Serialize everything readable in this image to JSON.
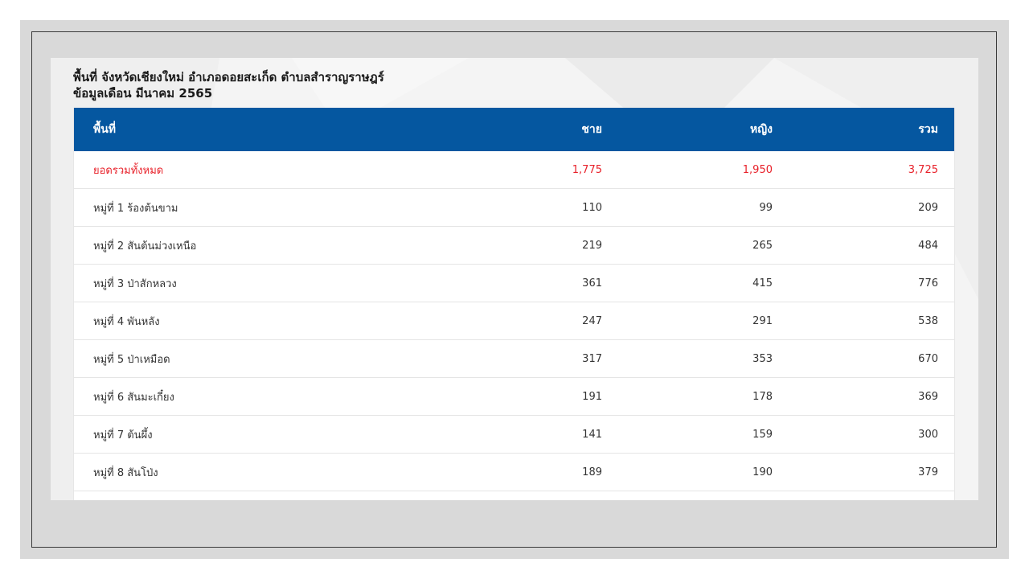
{
  "heading": {
    "line1": "พื้นที่ จังหวัดเชียงใหม่ อำเภอดอยสะเก็ด ตำบลสำราญราษฎร์",
    "line2": "ข้อมูลเดือน มีนาคม 2565"
  },
  "table": {
    "columns": [
      "พื้นที่",
      "ชาย",
      "หญิง",
      "รวม"
    ],
    "total": {
      "area": "ยอดรวมทั้งหมด",
      "male": "1,775",
      "female": "1,950",
      "sum": "3,725"
    },
    "rows": [
      {
        "area": "หมู่ที่ 1 ร้องต้นขาม",
        "male": "110",
        "female": "99",
        "sum": "209"
      },
      {
        "area": "หมู่ที่ 2 สันต้นม่วงเหนือ",
        "male": "219",
        "female": "265",
        "sum": "484"
      },
      {
        "area": "หมู่ที่ 3 ป่าสักหลวง",
        "male": "361",
        "female": "415",
        "sum": "776"
      },
      {
        "area": "หมู่ที่ 4 พันหลัง",
        "male": "247",
        "female": "291",
        "sum": "538"
      },
      {
        "area": "หมู่ที่ 5 ป่าเหมือด",
        "male": "317",
        "female": "353",
        "sum": "670"
      },
      {
        "area": "หมู่ที่ 6 สันมะเกี๋ยง",
        "male": "191",
        "female": "178",
        "sum": "369"
      },
      {
        "area": "หมู่ที่ 7 ต้นผึ้ง",
        "male": "141",
        "female": "159",
        "sum": "300"
      },
      {
        "area": "หมู่ที่ 8 สันโป่ง",
        "male": "189",
        "female": "190",
        "sum": "379"
      }
    ]
  },
  "colors": {
    "header_bg": "#0557a0",
    "total_text": "#e8212a",
    "slide_bg": "#d9d9d9"
  }
}
